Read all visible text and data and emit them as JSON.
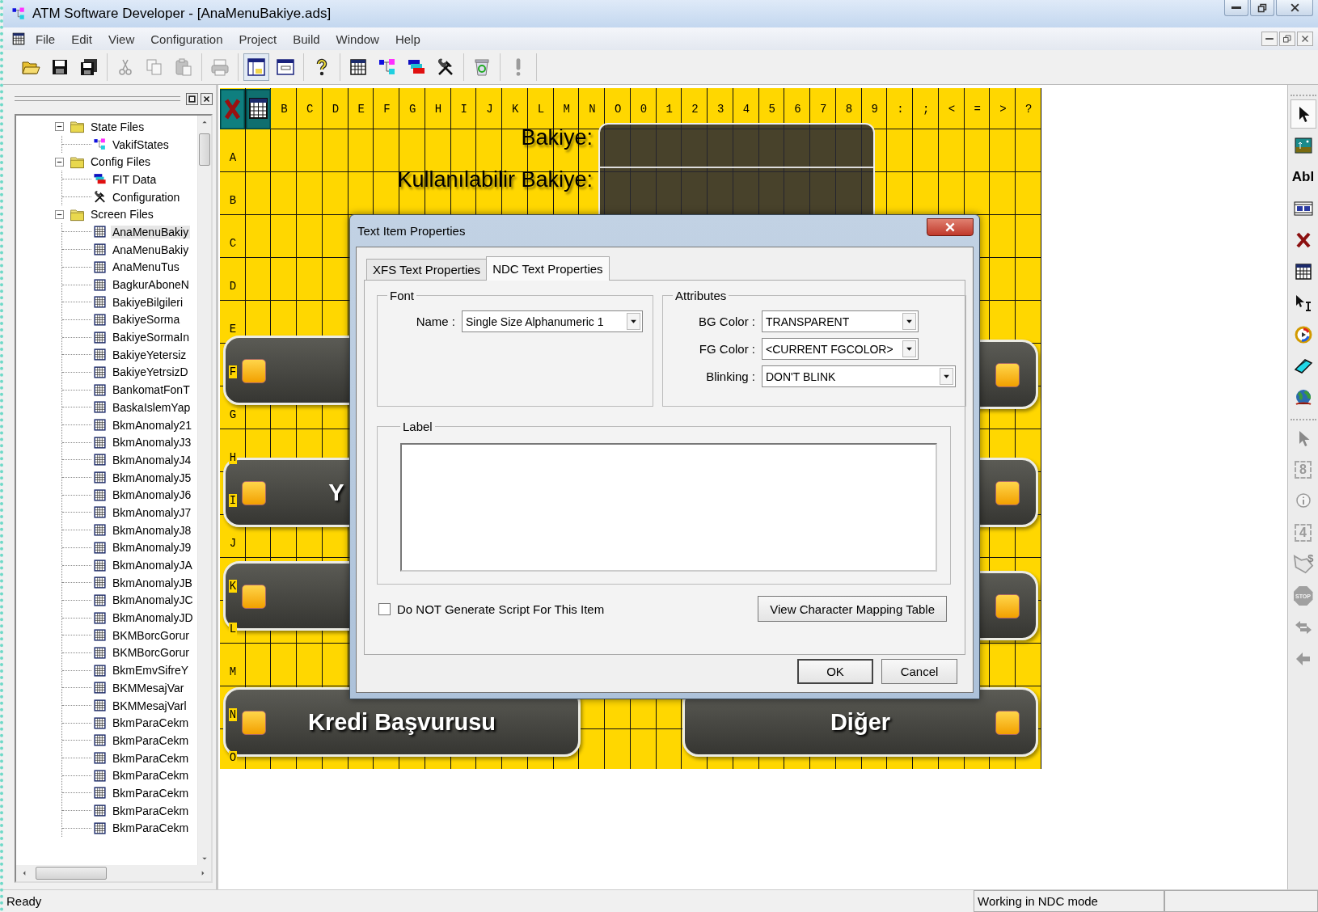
{
  "window": {
    "title": "ATM Software Developer - [AnaMenuBakiye.ads]"
  },
  "menu": [
    "File",
    "Edit",
    "View",
    "Configuration",
    "Project",
    "Build",
    "Window",
    "Help"
  ],
  "toolbar": [
    [
      {
        "kind": "open",
        "disabled": false,
        "pressed": false
      },
      {
        "kind": "save",
        "disabled": false,
        "pressed": false
      },
      {
        "kind": "save-all",
        "disabled": false,
        "pressed": false
      }
    ],
    [
      {
        "kind": "cut",
        "disabled": true,
        "pressed": false
      },
      {
        "kind": "copy",
        "disabled": true,
        "pressed": false
      },
      {
        "kind": "paste",
        "disabled": true,
        "pressed": false
      }
    ],
    [
      {
        "kind": "print",
        "disabled": true,
        "pressed": false
      }
    ],
    [
      {
        "kind": "layout",
        "disabled": false,
        "pressed": true
      },
      {
        "kind": "dialog-layout",
        "disabled": false,
        "pressed": false
      }
    ],
    [
      {
        "kind": "help",
        "disabled": false,
        "pressed": false
      }
    ],
    [
      {
        "kind": "grid",
        "disabled": false,
        "pressed": false
      },
      {
        "kind": "states",
        "disabled": false,
        "pressed": false
      },
      {
        "kind": "fit",
        "disabled": false,
        "pressed": false
      },
      {
        "kind": "tools",
        "disabled": false,
        "pressed": false
      }
    ],
    [
      {
        "kind": "recycle",
        "disabled": false,
        "pressed": false
      }
    ],
    [
      {
        "kind": "alert",
        "disabled": true,
        "pressed": false
      }
    ]
  ],
  "tree": [
    {
      "label": "State Files",
      "kind": "folder",
      "expanded": true,
      "selected": false,
      "children": [
        {
          "label": "VakifStates",
          "kind": "states",
          "selected": false
        }
      ]
    },
    {
      "label": "Config Files",
      "kind": "folder",
      "expanded": true,
      "selected": false,
      "children": [
        {
          "label": "FIT Data",
          "kind": "fit",
          "selected": false
        },
        {
          "label": "Configuration",
          "kind": "tools",
          "selected": false
        }
      ]
    },
    {
      "label": "Screen Files",
      "kind": "folder",
      "expanded": true,
      "selected": false,
      "children": [
        {
          "label": "AnaMenuBakiy",
          "kind": "screen",
          "selected": true
        },
        {
          "label": "AnaMenuBakiy",
          "kind": "screen",
          "selected": false
        },
        {
          "label": "AnaMenuTus",
          "kind": "screen",
          "selected": false
        },
        {
          "label": "BagkurAboneN",
          "kind": "screen",
          "selected": false
        },
        {
          "label": "BakiyeBilgileri",
          "kind": "screen",
          "selected": false
        },
        {
          "label": "BakiyeSorma",
          "kind": "screen",
          "selected": false
        },
        {
          "label": "BakiyeSormaIn",
          "kind": "screen",
          "selected": false
        },
        {
          "label": "BakiyeYetersiz",
          "kind": "screen",
          "selected": false
        },
        {
          "label": "BakiyeYetrsizD",
          "kind": "screen",
          "selected": false
        },
        {
          "label": "BankomatFonT",
          "kind": "screen",
          "selected": false
        },
        {
          "label": "BaskaIslemYap",
          "kind": "screen",
          "selected": false
        },
        {
          "label": "BkmAnomaly21",
          "kind": "screen",
          "selected": false
        },
        {
          "label": "BkmAnomalyJ3",
          "kind": "screen",
          "selected": false
        },
        {
          "label": "BkmAnomalyJ4",
          "kind": "screen",
          "selected": false
        },
        {
          "label": "BkmAnomalyJ5",
          "kind": "screen",
          "selected": false
        },
        {
          "label": "BkmAnomalyJ6",
          "kind": "screen",
          "selected": false
        },
        {
          "label": "BkmAnomalyJ7",
          "kind": "screen",
          "selected": false
        },
        {
          "label": "BkmAnomalyJ8",
          "kind": "screen",
          "selected": false
        },
        {
          "label": "BkmAnomalyJ9",
          "kind": "screen",
          "selected": false
        },
        {
          "label": "BkmAnomalyJA",
          "kind": "screen",
          "selected": false
        },
        {
          "label": "BkmAnomalyJB",
          "kind": "screen",
          "selected": false
        },
        {
          "label": "BkmAnomalyJC",
          "kind": "screen",
          "selected": false
        },
        {
          "label": "BkmAnomalyJD",
          "kind": "screen",
          "selected": false
        },
        {
          "label": "BKMBorcGorur",
          "kind": "screen",
          "selected": false
        },
        {
          "label": "BKMBorcGorur",
          "kind": "screen",
          "selected": false
        },
        {
          "label": "BkmEmvSifreY",
          "kind": "screen",
          "selected": false
        },
        {
          "label": "BKMMesajVar",
          "kind": "screen",
          "selected": false
        },
        {
          "label": "BKMMesajVarl",
          "kind": "screen",
          "selected": false
        },
        {
          "label": "BkmParaCekm",
          "kind": "screen",
          "selected": false
        },
        {
          "label": "BkmParaCekm",
          "kind": "screen",
          "selected": false
        },
        {
          "label": "BkmParaCekm",
          "kind": "screen",
          "selected": false
        },
        {
          "label": "BkmParaCekm",
          "kind": "screen",
          "selected": false
        },
        {
          "label": "BkmParaCekm",
          "kind": "screen",
          "selected": false
        },
        {
          "label": "BkmParaCekm",
          "kind": "screen",
          "selected": false
        },
        {
          "label": "BkmParaCekm",
          "kind": "screen",
          "selected": false
        }
      ]
    }
  ],
  "canvas": {
    "column_headers": [
      "B",
      "C",
      "D",
      "E",
      "F",
      "G",
      "H",
      "I",
      "J",
      "K",
      "L",
      "M",
      "N",
      "O",
      "0",
      "1",
      "2",
      "3",
      "4",
      "5",
      "6",
      "7",
      "8",
      "9",
      ":",
      ";",
      "<",
      "=",
      ">",
      "?"
    ],
    "row_headers": [
      "A",
      "B",
      "C",
      "D",
      "E",
      "F",
      "G",
      "H",
      "I",
      "J",
      "K",
      "L",
      "M",
      "N",
      "O"
    ],
    "labels": [
      "Bakiye:",
      "Kullanılabilir Bakiye:"
    ],
    "keys": [
      {
        "kind": "left"
      },
      {
        "kind": "left",
        "label": "Y"
      },
      {
        "kind": "left"
      },
      {
        "kind": "left",
        "label": "Kredi Başvurusu"
      },
      {
        "kind": "right"
      },
      {
        "kind": "right"
      },
      {
        "kind": "right"
      },
      {
        "kind": "right",
        "label": "Diğer"
      }
    ]
  },
  "right_toolbar": [
    [
      {
        "kind": "pointer",
        "disabled": false,
        "selected": true
      },
      {
        "kind": "picture",
        "disabled": false,
        "selected": false
      },
      {
        "kind": "text",
        "label": "Abl",
        "disabled": false,
        "selected": false
      },
      {
        "kind": "video",
        "disabled": false,
        "selected": false
      },
      {
        "kind": "cross",
        "disabled": false,
        "selected": false
      },
      {
        "kind": "grid",
        "disabled": false,
        "selected": false
      },
      {
        "kind": "text-cursor",
        "disabled": false,
        "selected": false
      },
      {
        "kind": "disc",
        "disabled": false,
        "selected": false
      },
      {
        "kind": "card",
        "disabled": false,
        "selected": false
      },
      {
        "kind": "globe",
        "disabled": false,
        "selected": false
      }
    ],
    [
      {
        "kind": "pointer",
        "disabled": true,
        "selected": false
      },
      {
        "kind": "digit",
        "label": "8",
        "disabled": true,
        "selected": false
      },
      {
        "kind": "info",
        "disabled": true,
        "selected": false
      },
      {
        "kind": "digit",
        "label": "4",
        "disabled": true,
        "selected": false
      },
      {
        "kind": "pay",
        "label": "$",
        "disabled": true,
        "selected": false
      },
      {
        "kind": "stop",
        "label": "STOP",
        "disabled": true,
        "selected": false
      },
      {
        "kind": "swap",
        "disabled": true,
        "selected": false
      },
      {
        "kind": "back",
        "disabled": true,
        "selected": false
      }
    ]
  ],
  "dialog": {
    "title": "Text Item Properties",
    "tabs": [
      {
        "label": "XFS Text Properties",
        "selected": false
      },
      {
        "label": "NDC Text Properties",
        "selected": true
      }
    ],
    "font_group": {
      "title": "Font",
      "name_label": "Name :",
      "name_value": "Single Size Alphanumeric 1"
    },
    "attributes_group": {
      "title": "Attributes",
      "fields": [
        {
          "label": "BG Color :",
          "value": "TRANSPARENT"
        },
        {
          "label": "FG Color :",
          "value": "<CURRENT FGCOLOR>"
        },
        {
          "label": "Blinking :",
          "value": "DON'T BLINK"
        }
      ]
    },
    "label_group": {
      "title": "Label"
    },
    "checkbox": {
      "label": "Do NOT Generate Script For This Item",
      "checked": false
    },
    "mapping_button": "View Character Mapping Table",
    "buttons": [
      "OK",
      "Cancel"
    ]
  },
  "status_bar": [
    "Ready",
    "Working in NDC mode"
  ]
}
